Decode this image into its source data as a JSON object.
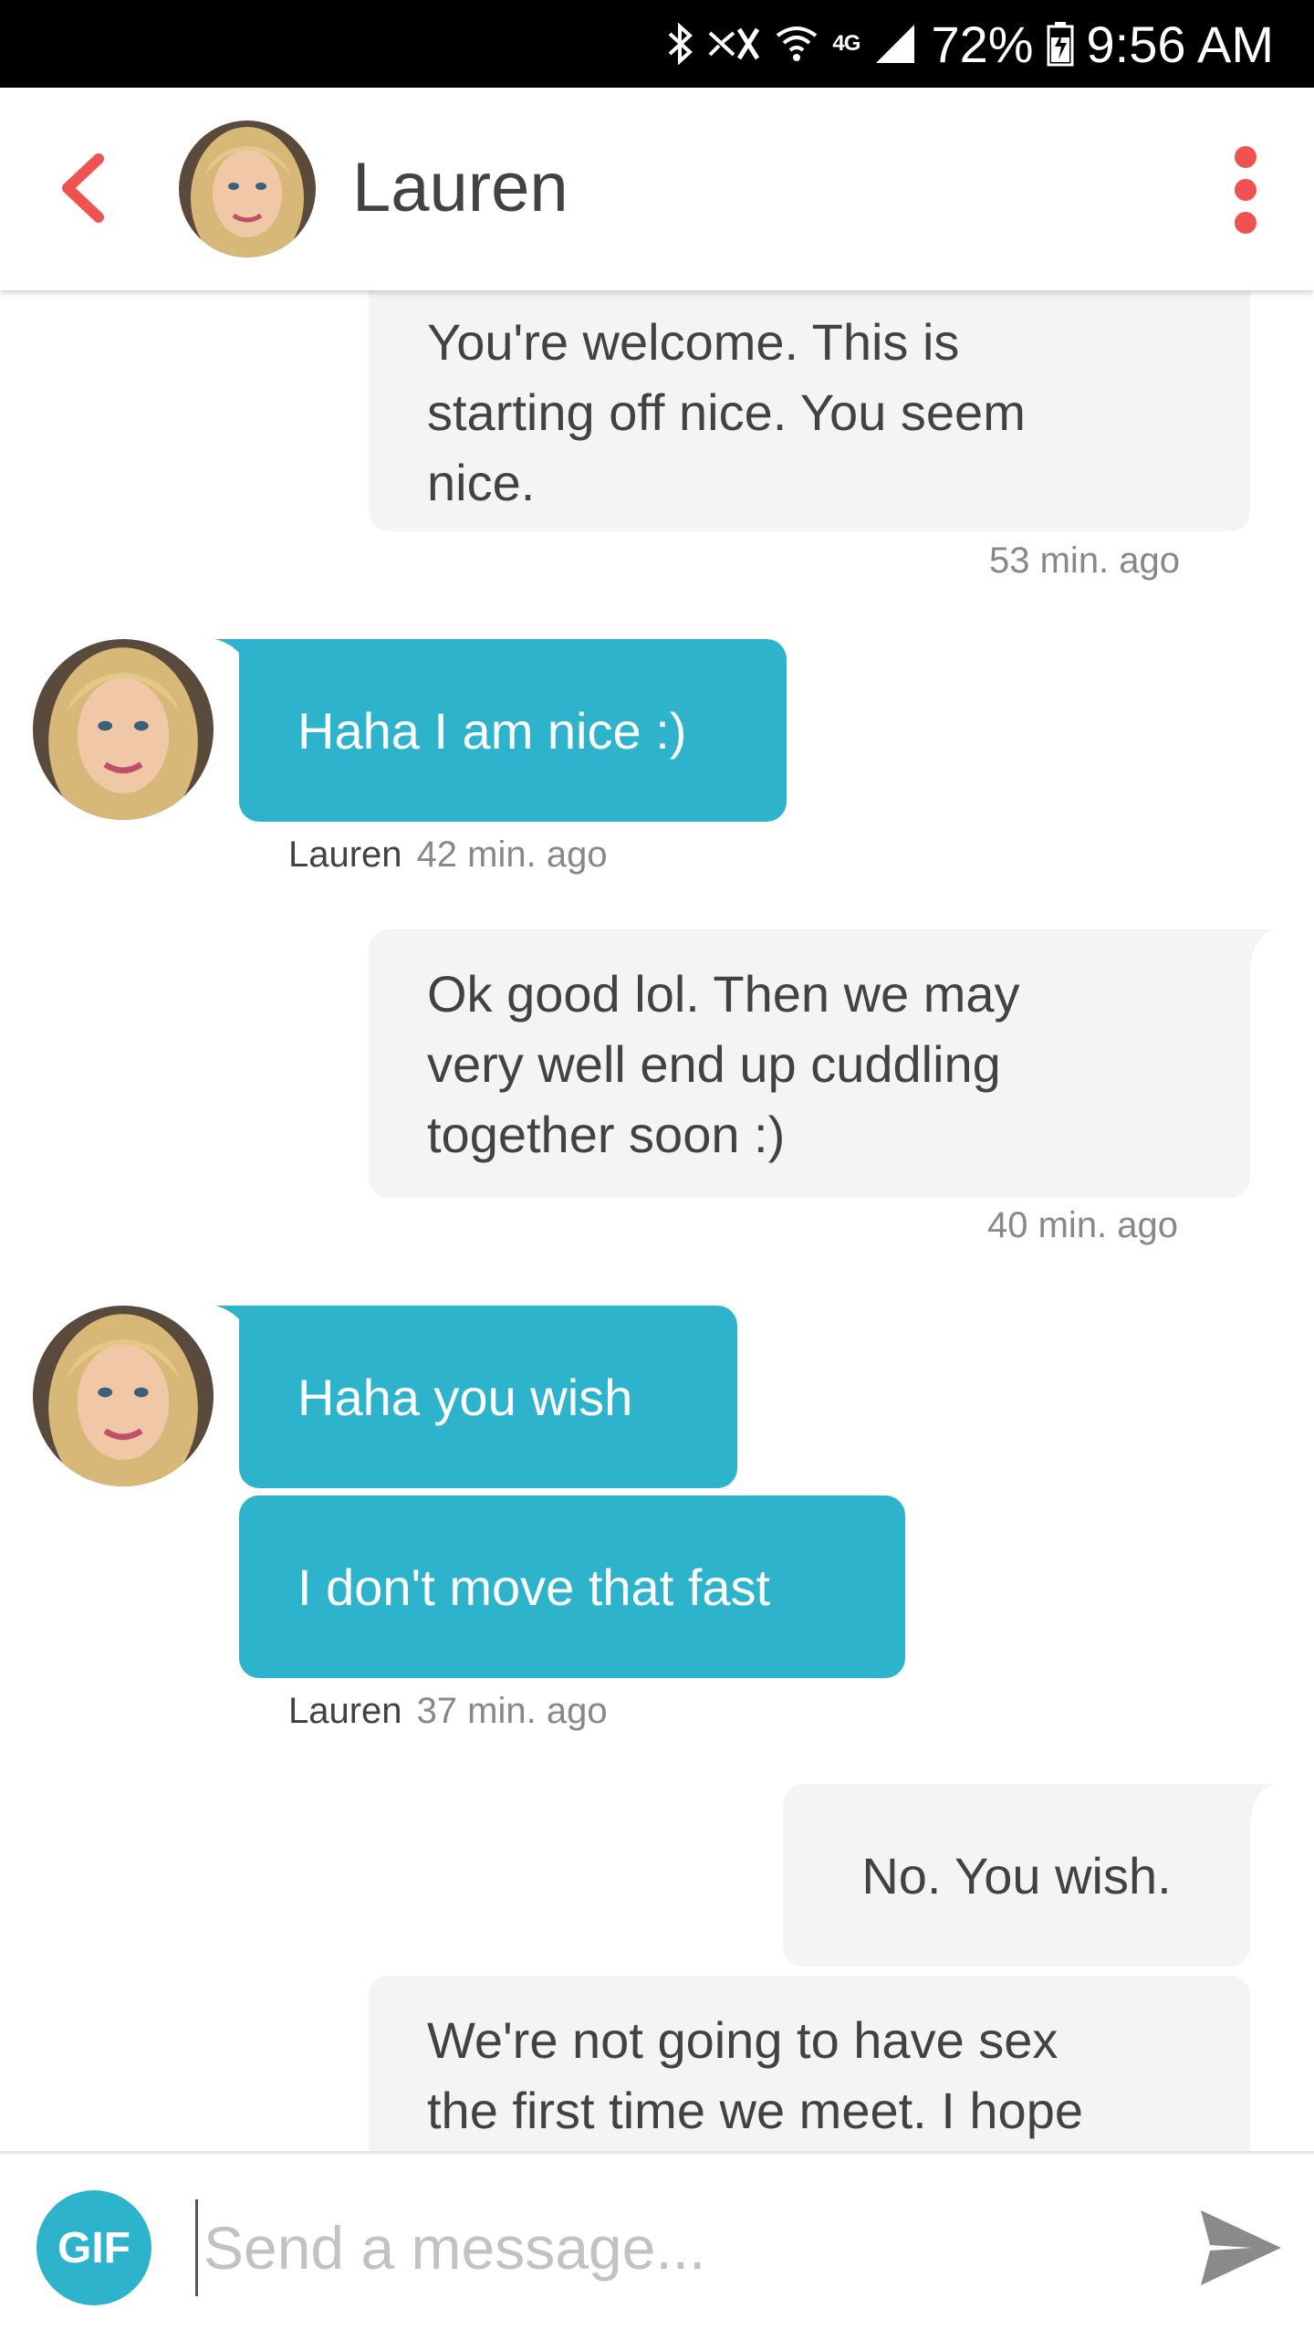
{
  "status_bar": {
    "network_label": "4G",
    "battery": "72%",
    "time": "9:56 AM",
    "icons": [
      "bluetooth-icon",
      "mute-icon",
      "wifi-icon",
      "signal-icon",
      "battery-icon"
    ]
  },
  "header": {
    "contact_name": "Lauren",
    "back_icon": "chevron-left-icon",
    "menu_icon": "more-vertical-icon",
    "accent_color": "#f05252"
  },
  "messages": [
    {
      "from": "me",
      "lines": [
        "You're welcome. This is",
        "starting off nice. You seem",
        "nice."
      ],
      "time": "53 min. ago"
    },
    {
      "from": "them",
      "text": "Haha I am nice :)",
      "sender": "Lauren",
      "time": "42 min. ago"
    },
    {
      "from": "me",
      "lines": [
        "Ok good lol. Then we may",
        "very well end up cuddling",
        "together soon :)"
      ],
      "time": "40 min. ago"
    },
    {
      "from": "them",
      "text": "Haha you wish"
    },
    {
      "from": "them",
      "text": "I don't move that fast",
      "sender": "Lauren",
      "time": "37 min. ago"
    },
    {
      "from": "me",
      "text": "No. You wish."
    },
    {
      "from": "me",
      "lines": [
        "We're not going to have sex",
        "the first time we meet. I hope"
      ]
    }
  ],
  "composer": {
    "gif_label": "GIF",
    "placeholder": "Send a message...",
    "value": ""
  },
  "colors": {
    "them_bubble": "#2db3cb",
    "me_bubble": "#f4f4f4",
    "text": "#424242"
  }
}
